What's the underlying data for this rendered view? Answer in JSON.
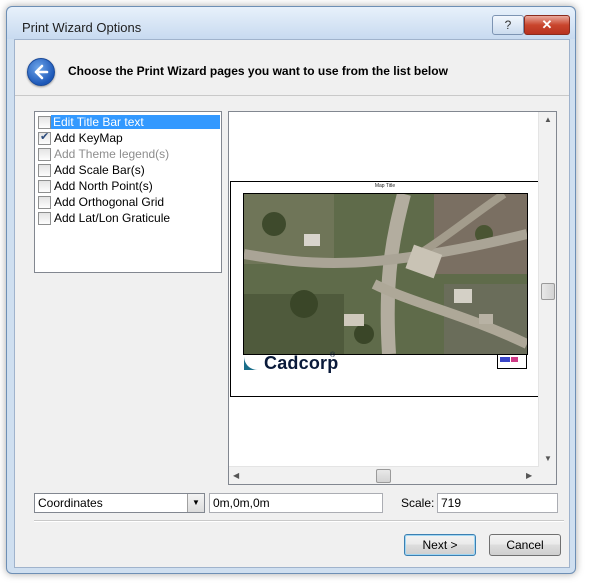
{
  "window": {
    "title": "Print Wizard Options",
    "help_label": "?",
    "close_label": "✕"
  },
  "header": {
    "instruction": "Choose the Print Wizard pages you want to use from the list below"
  },
  "pages_list": {
    "items": [
      {
        "label": "Edit Title Bar text",
        "checked": false,
        "selected": true,
        "disabled": false
      },
      {
        "label": "Add KeyMap",
        "checked": true,
        "selected": false,
        "disabled": false
      },
      {
        "label": "Add Theme legend(s)",
        "checked": false,
        "selected": false,
        "disabled": true
      },
      {
        "label": "Add Scale Bar(s)",
        "checked": false,
        "selected": false,
        "disabled": false
      },
      {
        "label": "Add North Point(s)",
        "checked": false,
        "selected": false,
        "disabled": false
      },
      {
        "label": "Add Orthogonal Grid",
        "checked": false,
        "selected": false,
        "disabled": false
      },
      {
        "label": "Add Lat/Lon Graticule",
        "checked": false,
        "selected": false,
        "disabled": false
      }
    ]
  },
  "preview": {
    "map_title": "Map Title",
    "logo_text": "Cadcorp",
    "logo_reg": "®"
  },
  "coordinates": {
    "selected_option": "Coordinates",
    "value": "0m,0m,0m"
  },
  "scale": {
    "label": "Scale:",
    "value": "719"
  },
  "buttons": {
    "next_label": "Next >",
    "cancel_label": "Cancel"
  },
  "colors": {
    "selection": "#3399ff",
    "back_icon": "#1d58b8"
  },
  "icons": [
    "back-arrow-icon",
    "help-icon",
    "close-icon",
    "dropdown-arrow-icon",
    "checkbox-icon"
  ]
}
